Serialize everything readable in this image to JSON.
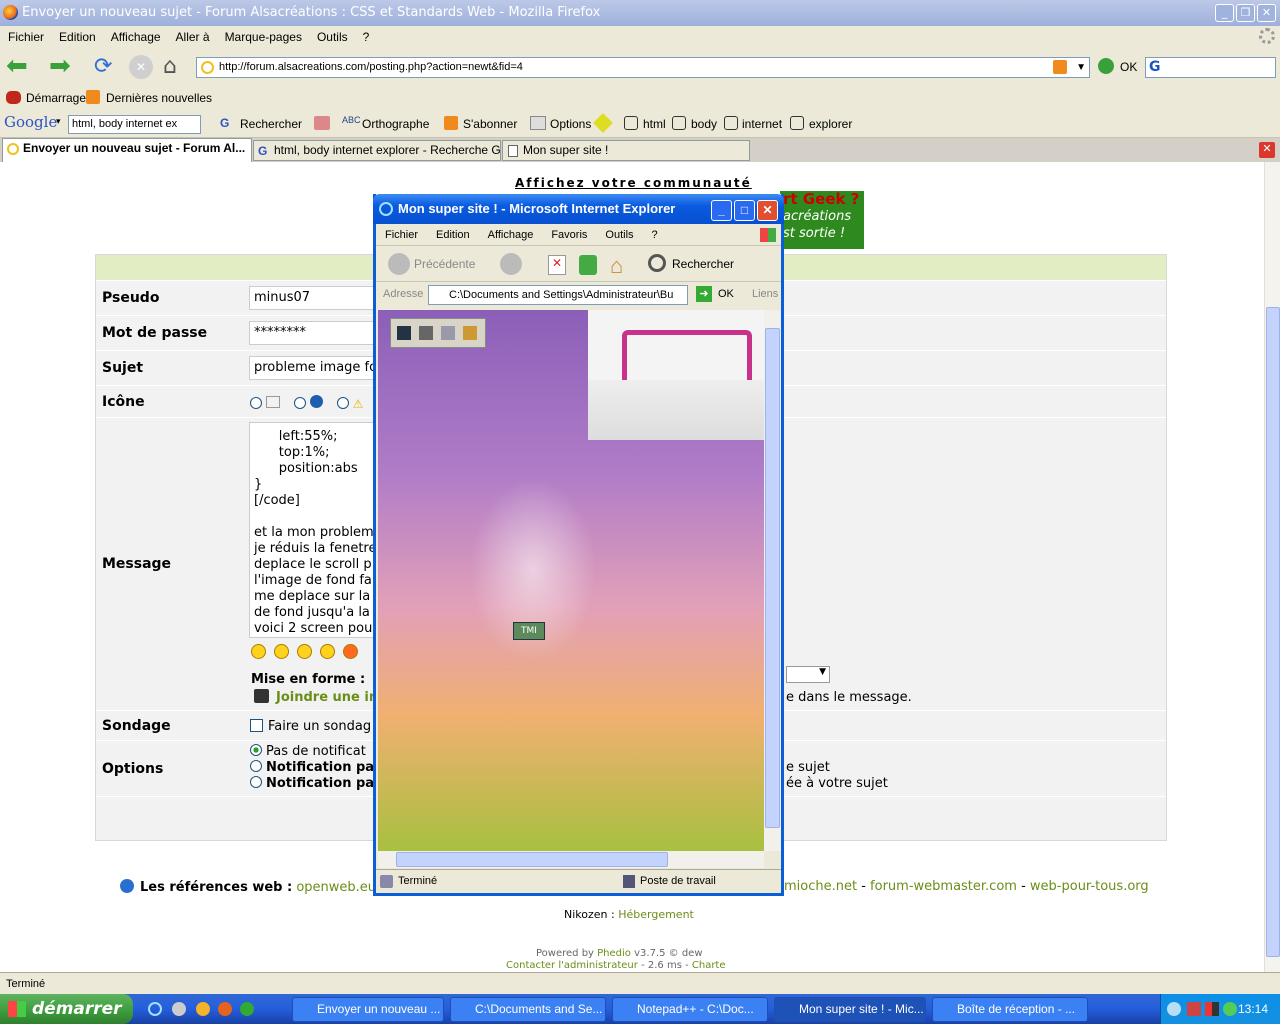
{
  "firefox": {
    "title": "Envoyer un nouveau sujet - Forum Alsacréations : CSS et Standards Web - Mozilla Firefox",
    "menu": [
      "Fichier",
      "Edition",
      "Affichage",
      "Aller à",
      "Marque-pages",
      "Outils",
      "?"
    ],
    "url": "http://forum.alsacreations.com/posting.php?action=newt&fid=4",
    "go_label": "OK",
    "bookmarks": [
      "Démarrage",
      "Dernières nouvelles"
    ],
    "google": {
      "logo": "Google",
      "query": "html, body internet ex",
      "buttons": [
        "Rechercher",
        "Orthographe",
        "S'abonner",
        "Options"
      ],
      "highlights": [
        "html",
        "body",
        "internet",
        "explorer"
      ]
    },
    "tabs": [
      "Envoyer un nouveau sujet - Forum Al...",
      "html, body internet explorer - Recherche G...",
      "Mon super site !"
    ],
    "status": "Terminé"
  },
  "page": {
    "banner_link": "Affichez votre communauté",
    "ad_text": [
      "rt Geek ?",
      "acréations",
      "st sortie !"
    ],
    "form": {
      "pseudo_label": "Pseudo",
      "pseudo_value": "minus07",
      "password_label": "Mot de passe",
      "password_value": "********",
      "subject_label": "Sujet",
      "subject_value": "probleme image fo",
      "icon_label": "Icône",
      "message_label": "Message",
      "message_text": "      left:55%;\n      top:1%;\n      position:abs\n}\n[/code]\n\net la mon problem\nje réduis la fenetre\ndeplace le scroll p\nl'image de fond fai\nme deplace sur la\nde fond jusqu'a la\nvoici 2 screen pou",
      "format_label": "Mise en forme :",
      "attach_link": "Joindre une im",
      "attach_tail": "e dans le message.",
      "poll_label": "Sondage",
      "poll_option": "Faire un sondag",
      "options_label": "Options",
      "options": [
        "Pas de notificat",
        "Notification pa",
        "Notification pa"
      ],
      "options_tail": [
        "e sujet",
        "ée à votre sujet"
      ]
    },
    "footer": {
      "refs_label": "Les références web :",
      "refs_first": "openweb.eu.c",
      "refs_rest": [
        " mioche.net",
        " forum-webmaster.com",
        " web-pour-tous.org"
      ],
      "nikozen": "Nikozen :",
      "hosting": "Hébergement",
      "powered": "Powered by",
      "phedio": "Phedio",
      "version": "v3.7.5 © dew",
      "contact": "Contacter l'administrateur",
      "timing": "- 2.6 ms -",
      "charte": "Charte"
    }
  },
  "ie": {
    "title": "Mon super site ! - Microsoft Internet Explorer",
    "menu": [
      "Fichier",
      "Edition",
      "Affichage",
      "Favoris",
      "Outils",
      "?"
    ],
    "back": "Précédente",
    "search": "Rechercher",
    "address_label": "Adresse",
    "address": "C:\\Documents and Settings\\Administrateur\\Bu",
    "go": "OK",
    "links": "Liens",
    "status": "Terminé",
    "zone": "Poste de travail",
    "thumb_label": "TMI"
  },
  "taskbar": {
    "start": "démarrer",
    "tasks": [
      "Envoyer un nouveau ...",
      "C:\\Documents and Se...",
      "Notepad++ - C:\\Doc...",
      "Mon super site ! - Mic...",
      "Boîte de réception - ..."
    ],
    "clock": "13:14"
  }
}
